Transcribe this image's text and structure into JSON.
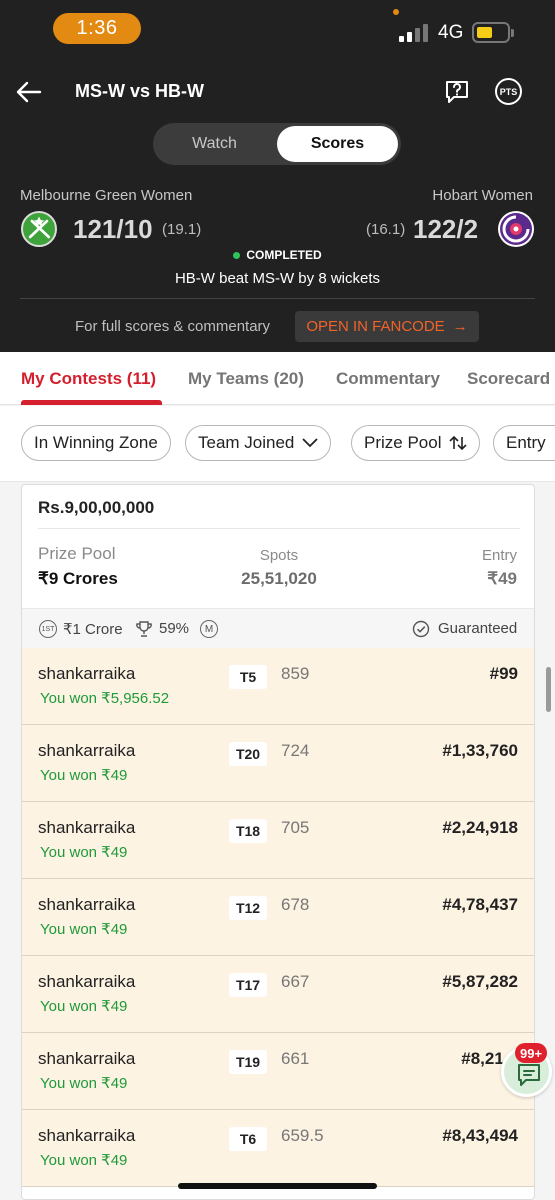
{
  "status_bar": {
    "time": "1:36",
    "network": "4G"
  },
  "header": {
    "match_title": "MS-W vs HB-W",
    "pts_label": "PTS"
  },
  "toggle": {
    "watch": "Watch",
    "scores": "Scores"
  },
  "teams": {
    "left": {
      "name": "Melbourne Green Women",
      "score": "121/10",
      "overs": "(19.1)"
    },
    "right": {
      "name": "Hobart Women",
      "score": "122/2",
      "overs": "(16.1)"
    }
  },
  "match_status": "COMPLETED",
  "result_text": "HB-W beat MS-W by 8 wickets",
  "fancode": {
    "text": "For full scores & commentary",
    "button": "OPEN IN FANCODE",
    "arrow": "→"
  },
  "tabs": [
    {
      "label": "My Contests (11)",
      "active": true
    },
    {
      "label": "My Teams (20)",
      "active": false
    },
    {
      "label": "Commentary",
      "active": false
    },
    {
      "label": "Scorecard",
      "active": false
    }
  ],
  "filters": [
    {
      "label": "In Winning Zone"
    },
    {
      "label": "Team Joined"
    },
    {
      "label": "Prize Pool"
    },
    {
      "label": "Entry"
    }
  ],
  "contest": {
    "prize_heading": "Rs.9,00,00,000",
    "prize_pool_label": "Prize Pool",
    "prize_pool_value": "₹9 Crores",
    "spots_label": "Spots",
    "spots_value": "25,51,020",
    "entry_label": "Entry",
    "entry_value": "₹49",
    "first_prize_badge": "1ST",
    "first_prize": "₹1 Crore",
    "winners_percent": "59%",
    "multi_badge": "M",
    "guaranteed": "Guaranteed"
  },
  "rows": [
    {
      "user": "shankarraika",
      "won": "You won ₹5,956.52",
      "team": "T5",
      "points": "859",
      "rank": "#99"
    },
    {
      "user": "shankarraika",
      "won": "You won ₹49",
      "team": "T20",
      "points": "724",
      "rank": "#1,33,760"
    },
    {
      "user": "shankarraika",
      "won": "You won ₹49",
      "team": "T18",
      "points": "705",
      "rank": "#2,24,918"
    },
    {
      "user": "shankarraika",
      "won": "You won ₹49",
      "team": "T12",
      "points": "678",
      "rank": "#4,78,437"
    },
    {
      "user": "shankarraika",
      "won": "You won ₹49",
      "team": "T17",
      "points": "667",
      "rank": "#5,87,282"
    },
    {
      "user": "shankarraika",
      "won": "You won ₹49",
      "team": "T19",
      "points": "661",
      "rank": "#8,21,2"
    },
    {
      "user": "shankarraika",
      "won": "You won ₹49",
      "team": "T6",
      "points": "659.5",
      "rank": "#8,43,494"
    }
  ],
  "chat_badge": "99+",
  "colors": {
    "accent": "#d41f2e",
    "win_green": "#1f9a3a",
    "header_bg": "#212121",
    "row_bg": "#fdf3e3",
    "fancode_orange": "#f0642a"
  }
}
